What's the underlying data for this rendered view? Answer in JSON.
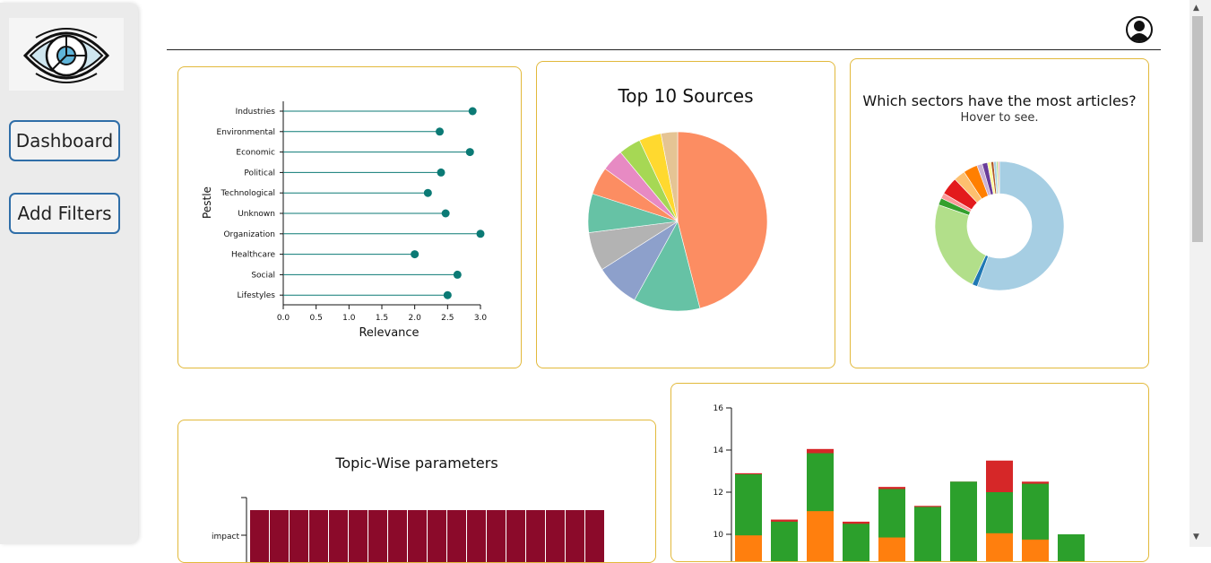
{
  "sidebar": {
    "logo": "eye-logo",
    "items": [
      {
        "label": "Dashboard"
      },
      {
        "label": "Add Filters"
      }
    ]
  },
  "header": {
    "avatar_icon": "user-avatar-icon"
  },
  "cards": {
    "pestle": {
      "xlabel": "Relevance",
      "ylabel": "Pestle",
      "xticks": [
        "0.0",
        "0.5",
        "1.0",
        "1.5",
        "2.0",
        "2.5",
        "3.0"
      ]
    },
    "sources": {
      "title": "Top 10 Sources"
    },
    "sectors": {
      "title": "Which sectors have the most articles?",
      "subtitle": "Hover to see."
    },
    "topic": {
      "title": "Topic-Wise parameters",
      "ylabel_visible": "impact"
    },
    "stacked": {
      "yticks": [
        "16",
        "14",
        "12",
        "10"
      ]
    }
  },
  "colors": {
    "accent_border": "#e2b93b",
    "nav_border": "#2f6ea8",
    "lollipop": "#0b7a75",
    "topic_bar": "#8b0a2a"
  },
  "chart_data": [
    {
      "type": "scatter",
      "ylabel": "Pestle",
      "xlabel": "Relevance",
      "xlim": [
        0,
        3
      ],
      "categories": [
        "Industries",
        "Environmental",
        "Economic",
        "Political",
        "Technological",
        "Unknown",
        "Organization",
        "Healthcare",
        "Social",
        "Lifestyles"
      ],
      "values": [
        2.88,
        2.38,
        2.84,
        2.4,
        2.2,
        2.47,
        3.0,
        2.0,
        2.65,
        2.5
      ]
    },
    {
      "type": "pie",
      "title": "Top 10 Sources",
      "values": [
        46,
        12,
        8,
        7,
        7,
        5,
        4,
        4,
        4,
        3
      ],
      "colors": [
        "#fc8d62",
        "#66c2a5",
        "#8da0cb",
        "#b3b3b3",
        "#66c2a5",
        "#fc8d62",
        "#e78ac3",
        "#a6d854",
        "#ffd92f",
        "#e5c494"
      ]
    },
    {
      "type": "pie",
      "title": "Which sectors have the most articles?",
      "values": [
        50,
        1.2,
        21,
        1.6,
        1.2,
        4,
        2.6,
        3.2,
        1.2,
        1.2,
        0.8,
        0.6,
        0.6,
        0.4,
        0.3
      ],
      "colors": [
        "#a6cee3",
        "#1f78b4",
        "#b2df8a",
        "#33a02c",
        "#fb9a99",
        "#e31a1c",
        "#fdbf6f",
        "#ff7f00",
        "#cab2d6",
        "#6a3d9a",
        "#ffff99",
        "#b15928",
        "#a6cee3",
        "#b2df8a",
        "#fb9a99"
      ]
    },
    {
      "type": "bar",
      "title": "Topic-Wise parameters",
      "categories": [
        "impact"
      ],
      "values": [
        18
      ]
    },
    {
      "type": "bar",
      "ylim": [
        9.4,
        16
      ],
      "series": [
        {
          "color": "#ff7f0e",
          "values": [
            9.95,
            0,
            11.1,
            0,
            9.85,
            0,
            0,
            10.05,
            9.75,
            0
          ]
        },
        {
          "color": "#2ca02c",
          "values": [
            12.85,
            10.6,
            13.85,
            10.5,
            12.15,
            11.3,
            12.5,
            12.0,
            12.4,
            10.0
          ]
        },
        {
          "color": "#d62728",
          "values": [
            12.9,
            10.7,
            14.05,
            10.6,
            12.25,
            11.35,
            12.5,
            13.5,
            12.5,
            10.0
          ]
        }
      ]
    }
  ]
}
